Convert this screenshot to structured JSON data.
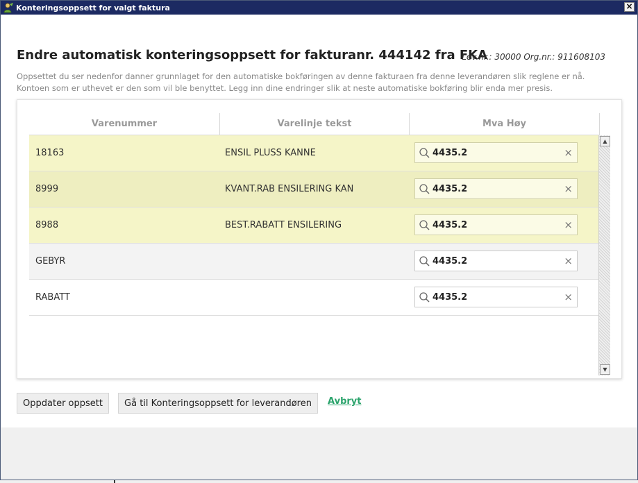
{
  "window": {
    "title": "Konteringsoppsett for valgt faktura",
    "close_glyph": "×"
  },
  "header": {
    "heading": "Endre automatisk konteringsoppsett for fakturanr. 444142 fra FKA",
    "meta": "Lev.nr.: 30000 Org.nr.: 911608103",
    "description": "Oppsettet du ser nedenfor danner grunnlaget for den automatiske bokføringen av denne fakturaen fra denne leverandøren slik reglene er nå. Kontoen som er uthevet er den som vil ble benyttet. Legg inn dine endringer slik at neste automatiske bokføring blir enda mer presis."
  },
  "grid": {
    "columns": [
      "Varenummer",
      "Varelinje tekst",
      "Mva Høy"
    ],
    "rows": [
      {
        "varenummer": "18163",
        "tekst": "ENSIL PLUSS KANNE",
        "konto": "4435.2",
        "highlighted": true
      },
      {
        "varenummer": "8999",
        "tekst": "KVANT.RAB ENSILERING KAN",
        "konto": "4435.2",
        "highlighted": true
      },
      {
        "varenummer": "8988",
        "tekst": "BEST.RABATT ENSILERING",
        "konto": "4435.2",
        "highlighted": true
      },
      {
        "varenummer": "GEBYR",
        "tekst": "",
        "konto": "4435.2",
        "highlighted": false
      },
      {
        "varenummer": "RABATT",
        "tekst": "",
        "konto": "4435.2",
        "highlighted": false
      }
    ],
    "clear_glyph": "×",
    "scroll_up_glyph": "▲",
    "scroll_down_glyph": "▼"
  },
  "actions": {
    "update_label": "Oppdater oppsett",
    "goto_label": "Gå til Konteringsoppsett for leverandøren",
    "cancel_label": "Avbryt"
  },
  "colors": {
    "titlebar": "#1c2a62",
    "highlight_row": "#f5f5c8",
    "link": "#2aa36b"
  },
  "icons": {
    "app": "leaf-user-icon",
    "search": "search-icon",
    "clear": "close-icon"
  }
}
